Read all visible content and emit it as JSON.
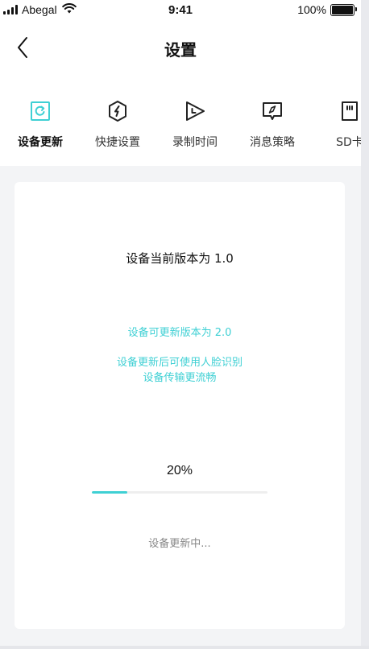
{
  "status_bar": {
    "carrier": "Abegal",
    "time": "9:41",
    "battery": "100%"
  },
  "nav": {
    "title": "设置"
  },
  "tabs": [
    {
      "label": "设备更新",
      "icon": "refresh-icon",
      "active": true
    },
    {
      "label": "快捷设置",
      "icon": "lightning-icon",
      "active": false
    },
    {
      "label": "录制时间",
      "icon": "play-clock-icon",
      "active": false
    },
    {
      "label": "消息策略",
      "icon": "message-compass-icon",
      "active": false
    },
    {
      "label": "SD卡",
      "icon": "sd-card-icon",
      "active": false
    }
  ],
  "update": {
    "current_version": "设备当前版本为 1.0",
    "available_version": "设备可更新版本为 2.0",
    "benefit_line1": "设备更新后可使用人脸识别",
    "benefit_line2": "设备传输更流畅",
    "progress_label": "20%",
    "progress_value": 0.2,
    "status": "设备更新中..."
  },
  "colors": {
    "accent": "#3fd0d4",
    "page_bg": "#f3f4f6",
    "card_bg": "#ffffff"
  }
}
